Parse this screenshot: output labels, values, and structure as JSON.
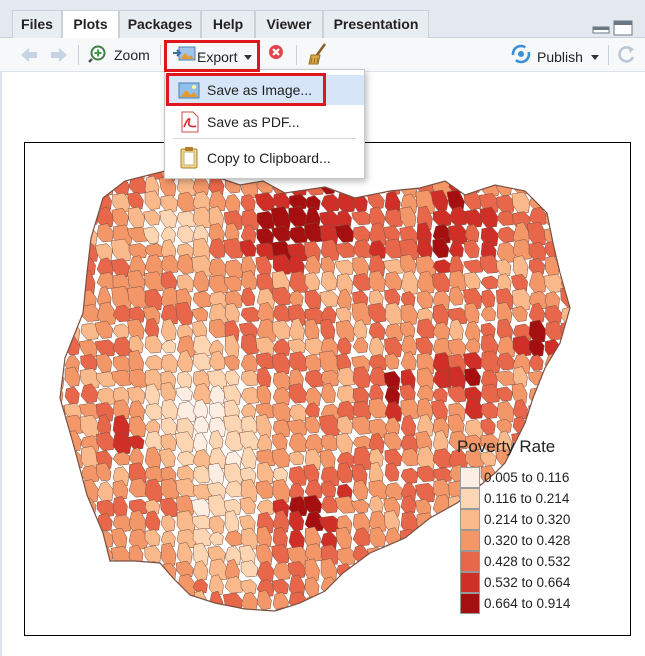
{
  "tabs": [
    {
      "label": "Files",
      "active": false
    },
    {
      "label": "Plots",
      "active": true
    },
    {
      "label": "Packages",
      "active": false
    },
    {
      "label": "Help",
      "active": false
    },
    {
      "label": "Viewer",
      "active": false
    },
    {
      "label": "Presentation",
      "active": false
    }
  ],
  "toolbar": {
    "zoom_label": "Zoom",
    "export_label": "Export",
    "publish_label": "Publish"
  },
  "export_menu": {
    "items": [
      {
        "label": "Save as Image...",
        "icon": "image-icon",
        "selected": true
      },
      {
        "label": "Save as PDF...",
        "icon": "pdf-icon",
        "selected": false
      },
      {
        "label": "Copy to Clipboard...",
        "icon": "clipboard-icon",
        "selected": false
      }
    ]
  },
  "plot": {
    "legend_title": "Poverty Rate",
    "legend": [
      {
        "label": "0.005 to 0.116",
        "color": "#fdeee3"
      },
      {
        "label": "0.116 to 0.214",
        "color": "#fcd5b2"
      },
      {
        "label": "0.214 to 0.320",
        "color": "#f9b98a"
      },
      {
        "label": "0.320 to 0.428",
        "color": "#f39668"
      },
      {
        "label": "0.428 to 0.532",
        "color": "#e8674a"
      },
      {
        "label": "0.532 to 0.664",
        "color": "#cf2f26"
      },
      {
        "label": "0.664 to 0.914",
        "color": "#a50f0f"
      }
    ]
  },
  "colors": {
    "highlight": "#e0161e",
    "menu_selected": "#d6e6f8",
    "map_outline": "#7a5040"
  }
}
